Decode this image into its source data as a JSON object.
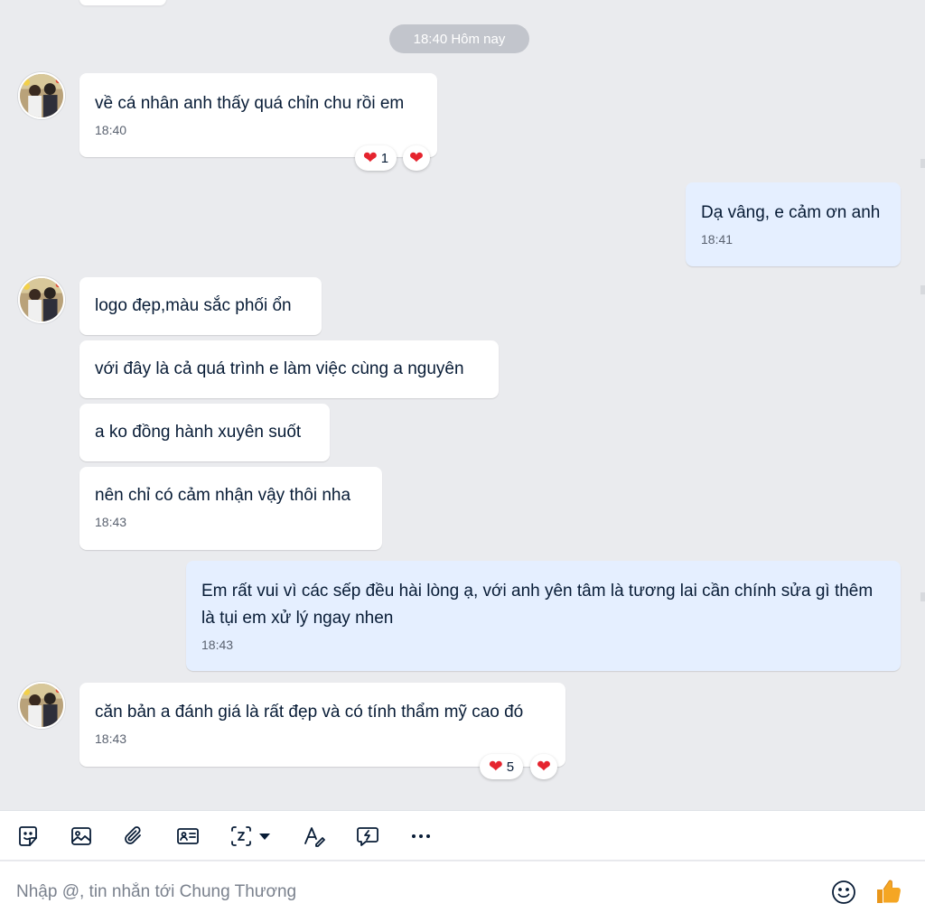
{
  "chat": {
    "date_separator": "18:40 Hôm nay",
    "messages": [
      {
        "text": "về cá nhân anh thấy quá chỉn chu rồi em",
        "time": "18:40",
        "reaction_count": "1"
      },
      {
        "text": "Dạ vâng, e cảm ơn anh",
        "time": "18:41"
      },
      {
        "text": "logo đẹp,màu sắc phối ổn"
      },
      {
        "text": "với đây là cả quá trình e làm việc cùng a nguyên"
      },
      {
        "text": "a ko đồng hành xuyên suốt"
      },
      {
        "text": "nên chỉ có cảm nhận vậy thôi nha",
        "time": "18:43"
      },
      {
        "text": "Em rất vui vì các sếp đều hài lòng ạ, với anh yên tâm là tương lai cần chính sửa gì thêm là tụi em xử lý ngay nhen",
        "time": "18:43"
      },
      {
        "text": "căn bản a đánh giá là rất đẹp và có tính thẩm mỹ cao đó",
        "time": "18:43",
        "reaction_count": "5"
      }
    ]
  },
  "toolbar": {
    "icons": [
      "sticker-icon",
      "image-icon",
      "attachment-icon",
      "contact-card-icon",
      "screenshot-icon",
      "dropdown-icon",
      "text-format-icon",
      "quick-message-icon",
      "more-icon"
    ]
  },
  "composer": {
    "placeholder": "Nhập @, tin nhắn tới Chung Thương"
  },
  "colors": {
    "background": "#eaebee",
    "own_bubble": "#e5efff",
    "other_bubble": "#ffffff",
    "heart": "#e5242e",
    "like": "#f5a623"
  }
}
